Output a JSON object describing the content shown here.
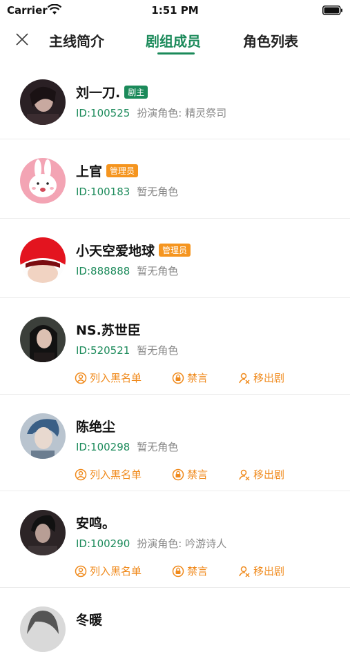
{
  "status": {
    "carrier": "Carrier",
    "time": "1:51 PM"
  },
  "nav": {
    "tabs": [
      "主线简介",
      "剧组成员",
      "角色列表"
    ],
    "active_tab": "剧组成员"
  },
  "colors": {
    "accent": "#1b8a5a",
    "orange": "#f5951f",
    "action": "#f08a1c"
  },
  "actions": {
    "blacklist": "列入黑名单",
    "mute": "禁言",
    "remove": "移出剧"
  },
  "members": [
    {
      "name": "刘一刀.",
      "badge": "剧主",
      "badge_color": "green",
      "id": "ID:100525",
      "role": "扮演角色: 精灵祭司",
      "has_actions": false
    },
    {
      "name": "上官",
      "badge": "管理员",
      "badge_color": "orange",
      "id": "ID:100183",
      "role": "暂无角色",
      "has_actions": false
    },
    {
      "name": "小天空爱地球",
      "badge": "管理员",
      "badge_color": "orange",
      "id": "ID:888888",
      "role": "暂无角色",
      "has_actions": false
    },
    {
      "name": "NS.苏世臣",
      "badge": "",
      "id": "ID:520521",
      "role": "暂无角色",
      "has_actions": true
    },
    {
      "name": "陈绝尘",
      "badge": "",
      "id": "ID:100298",
      "role": "暂无角色",
      "has_actions": true
    },
    {
      "name": "安鸣。",
      "badge": "",
      "id": "ID:100290",
      "role": "扮演角色: 吟游诗人",
      "has_actions": true
    },
    {
      "name": "冬暖",
      "badge": "",
      "id": "",
      "role": "",
      "has_actions": false
    }
  ]
}
